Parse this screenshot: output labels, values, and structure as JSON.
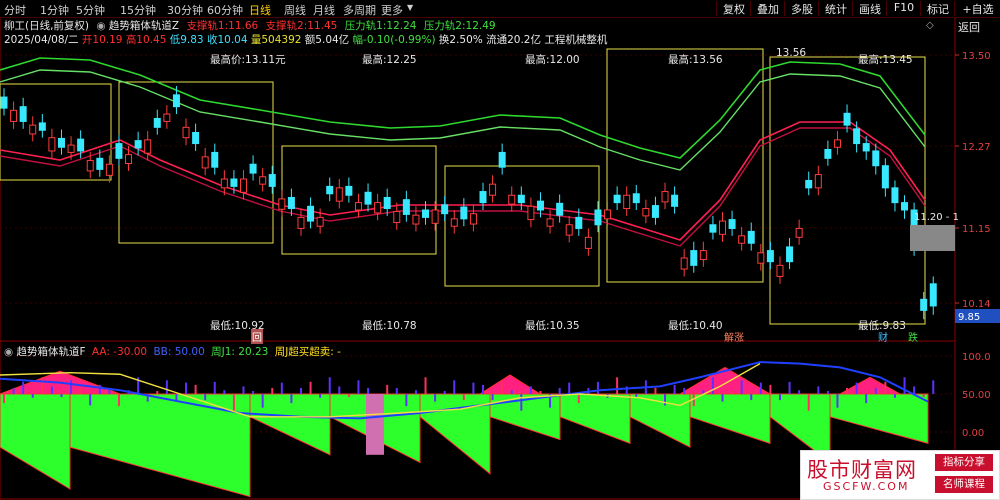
{
  "toolbar": {
    "periods": [
      "分时",
      "1分钟",
      "5分钟",
      "15分钟",
      "30分钟",
      "60分钟",
      "日线",
      "周线",
      "月线",
      "多周期",
      "更多"
    ],
    "active_period": "日线",
    "buttons": [
      "复权",
      "叠加",
      "多股",
      "统计",
      "画线",
      "F10",
      "标记",
      "+自选",
      "返回"
    ]
  },
  "header": {
    "stock": "柳工(日线,前复权)",
    "indicator": "趋势箱体轨道Z",
    "support1_label": "支撑轨1:",
    "support1_value": "11.66",
    "support2_label": "支撑轨2:",
    "support2_value": "11.45",
    "pressure1_label": "压力轨1:",
    "pressure1_value": "12.24",
    "pressure2_label": "压力轨2:",
    "pressure2_value": "12.49",
    "date": "2025/04/08/二",
    "open": "开10.19",
    "high": "高10.45",
    "low": "低9.83",
    "close": "收10.04",
    "volume": "量504392",
    "amount": "额5.04亿",
    "change": "幅-0.10(-0.99%)",
    "turnover": "换2.50%",
    "float": "流通20.2亿",
    "industry": "工程机械整机"
  },
  "price_axis": [
    "13.50",
    "12.27",
    "11.15",
    "10.14"
  ],
  "current_price_tag": "9.85",
  "crosshair_label": "11.20 - 1",
  "box_labels": {
    "highs": [
      "最高价:13.11元",
      "最高:12.25",
      "最高:12.00",
      "最高:13.56",
      "最高:13.45"
    ],
    "lows": [
      "最低:10.92",
      "最低:10.78",
      "最低:10.35",
      "最低:10.40",
      "最低:9.83"
    ],
    "peak_marker": "13.56"
  },
  "markers": {
    "hui": "回",
    "jiezhang": "解涨",
    "cai": "财",
    "die": "跌"
  },
  "sub": {
    "title": "趋势箱体轨道F",
    "aa": "AA: -30.00",
    "bb": "BB: 50.00",
    "zj1": "周J1: 20.23",
    "signal": "周J超买超卖: -",
    "axis": [
      "100.0",
      "50.00",
      "0.00"
    ]
  },
  "colors": {
    "up": "#ff3c3c",
    "down": "#38e8ff",
    "ma": "#ff2050",
    "channel": "#36d836",
    "box": "#e8e04a"
  },
  "watermark": {
    "main": "股市财富网",
    "sub": "GSCFW.COM",
    "tag1": "指标分享",
    "tag2": "名师课程"
  }
}
